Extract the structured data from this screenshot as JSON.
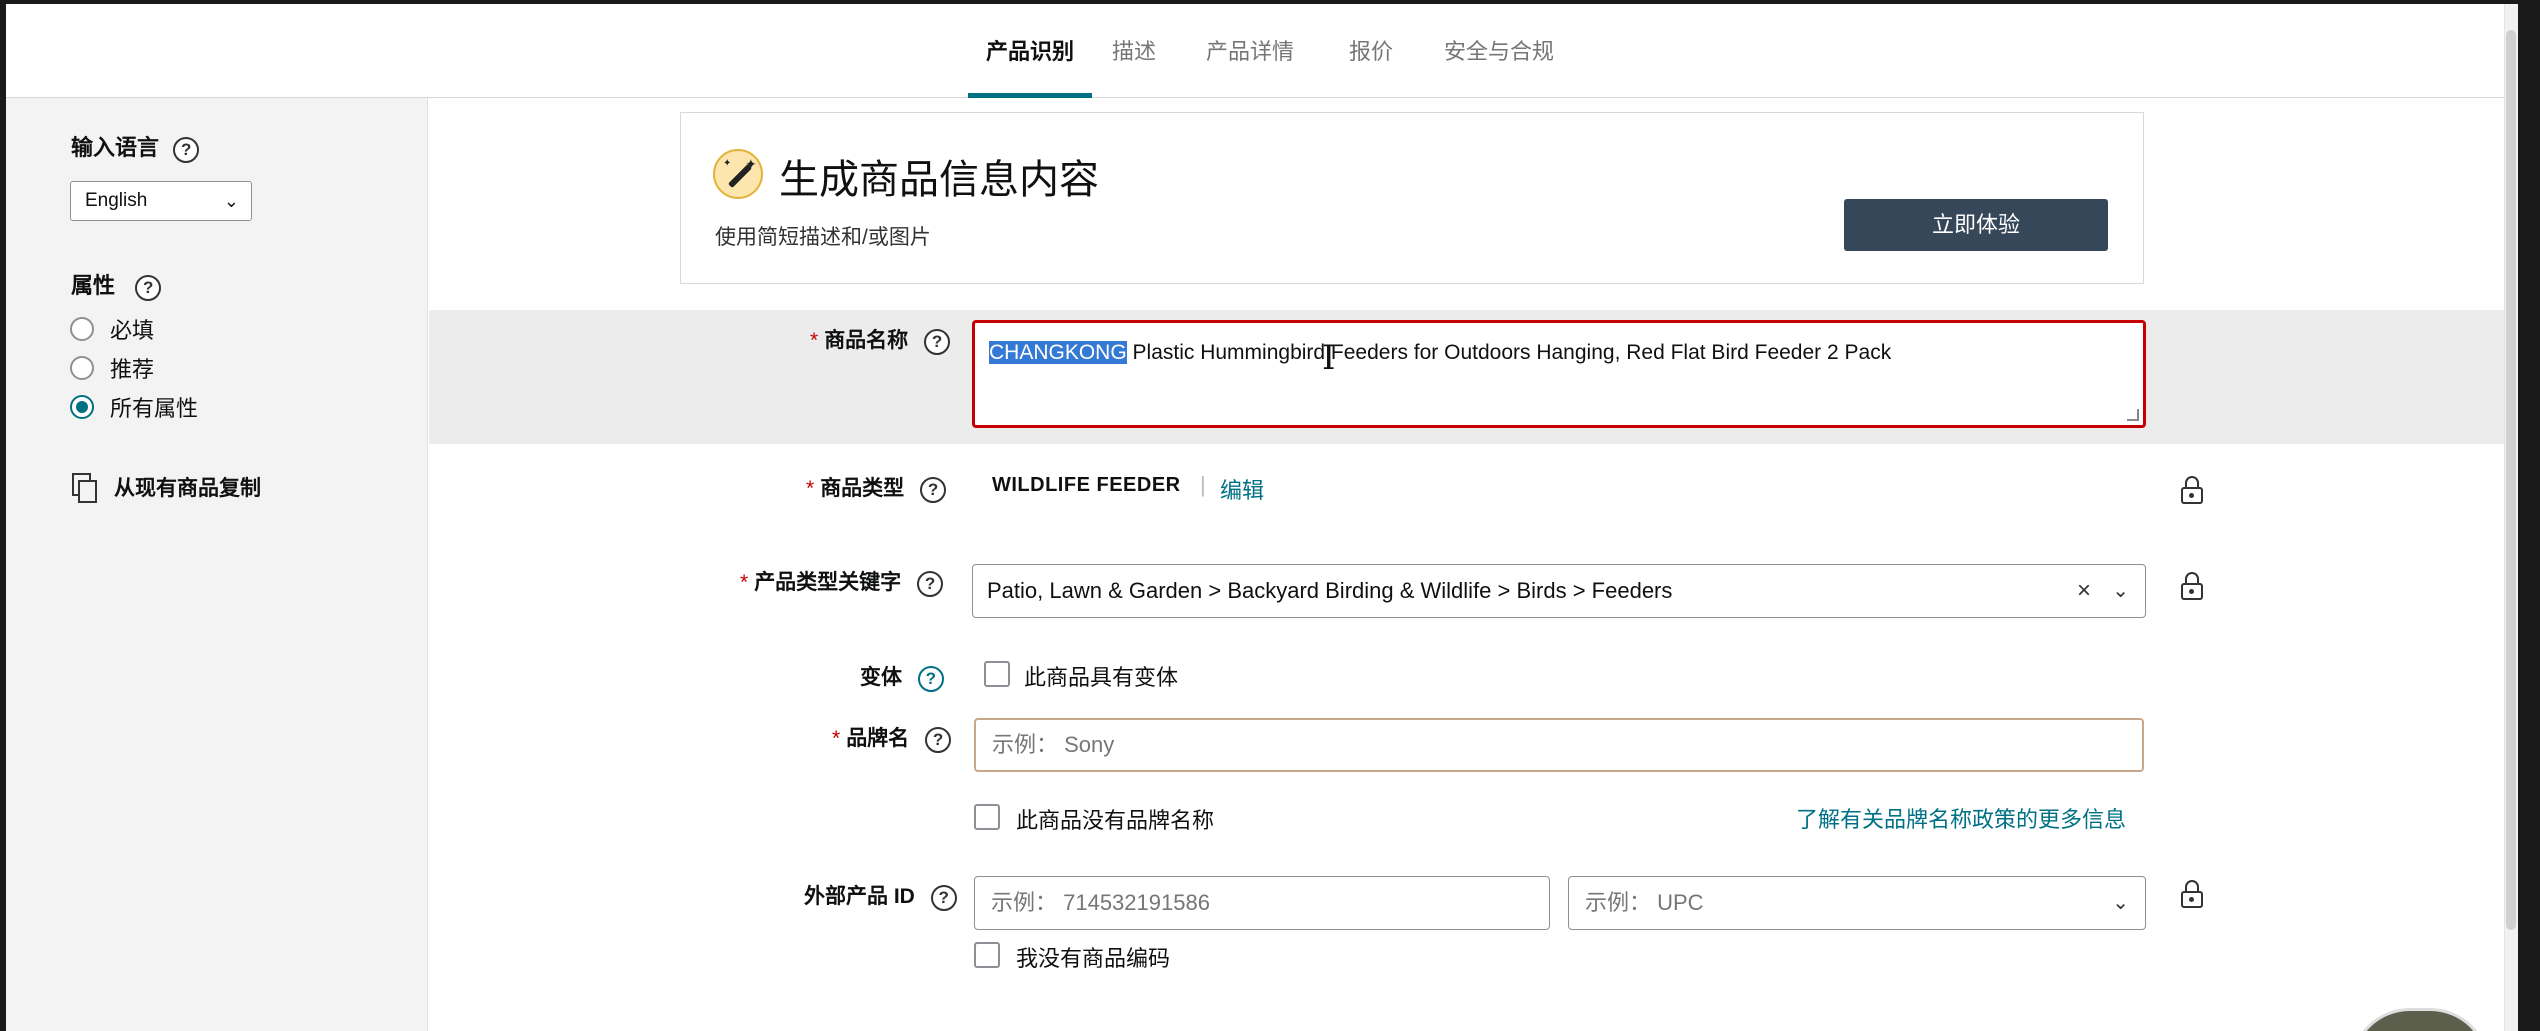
{
  "tabs": [
    {
      "label": "产品识别",
      "active": true
    },
    {
      "label": "描述",
      "active": false
    },
    {
      "label": "产品详情",
      "active": false
    },
    {
      "label": "报价",
      "active": false
    },
    {
      "label": "安全与合规",
      "active": false
    }
  ],
  "sidebar": {
    "input_language_label": "输入语言",
    "language_value": "English",
    "attributes_label": "属性",
    "attribute_options": [
      {
        "label": "必填",
        "selected": false
      },
      {
        "label": "推荐",
        "selected": false
      },
      {
        "label": "所有属性",
        "selected": true
      }
    ],
    "copy_label": "从现有商品复制"
  },
  "ai_banner": {
    "title": "生成商品信息内容",
    "subtitle": "使用简短描述和/或图片",
    "button_label": "立即体验"
  },
  "form": {
    "required_mark": "*",
    "product_name": {
      "label": "商品名称",
      "selected_text": "CHANGKONG",
      "rest_text": " Plastic Hummingbird Feeders for Outdoors Hanging, Red Flat Bird Feeder 2 Pack"
    },
    "product_type": {
      "label": "商品类型",
      "value": "WILDLIFE FEEDER",
      "separator": "|",
      "edit_label": "编辑"
    },
    "type_keyword": {
      "label": "产品类型关键字",
      "value": "Patio, Lawn & Garden > Backyard Birding & Wildlife > Birds > Feeders"
    },
    "variation": {
      "label": "变体",
      "checkbox_label": "此商品具有变体"
    },
    "brand": {
      "label": "品牌名",
      "placeholder": "示例： Sony",
      "no_brand_label": "此商品没有品牌名称",
      "policy_link": "了解有关品牌名称政策的更多信息"
    },
    "external_id": {
      "label": "外部产品 ID",
      "id_placeholder": "示例： 714532191586",
      "type_placeholder": "示例： UPC",
      "no_code_label": "我没有商品编码"
    }
  },
  "icons": {
    "help": "?",
    "chevron": "⌄",
    "clear": "×",
    "cursor": "I"
  },
  "colors": {
    "accent": "#007185",
    "error": "#c40000",
    "button_dark": "#37475a"
  }
}
